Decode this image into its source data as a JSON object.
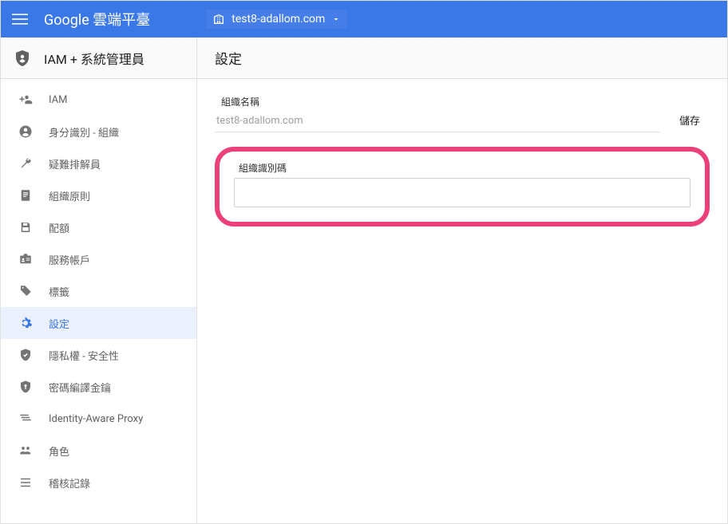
{
  "header": {
    "app_title": "Google 雲端平臺",
    "project_name": "test8-adallom.com"
  },
  "sidebar": {
    "section_title": "IAM + 系統管理員",
    "items": [
      {
        "label": "IAM",
        "icon": "person-add"
      },
      {
        "label": "身分識別 - 組織",
        "icon": "account-circle"
      },
      {
        "label": "疑難排解員",
        "icon": "wrench"
      },
      {
        "label": "組織原則",
        "icon": "doc"
      },
      {
        "label": "配額",
        "icon": "save"
      },
      {
        "label": "服務帳戶",
        "icon": "badge"
      },
      {
        "label": "標籤",
        "icon": "tag"
      },
      {
        "label": "設定",
        "icon": "gear"
      },
      {
        "label": "隱私權 - 安全性",
        "icon": "shield-check"
      },
      {
        "label": "密碼編譯金鑰",
        "icon": "shield-key"
      },
      {
        "label": "Identity-Aware Proxy",
        "icon": "layers"
      },
      {
        "label": "角色",
        "icon": "roles"
      },
      {
        "label": "稽核記錄",
        "icon": "list"
      }
    ],
    "selected_index": 7
  },
  "main": {
    "title": "設定",
    "org_name_label": "組織名稱",
    "org_name_value": "test8-adallom.com",
    "save_label": "儲存",
    "org_id_label": "組織識別碼",
    "org_id_value": ""
  }
}
